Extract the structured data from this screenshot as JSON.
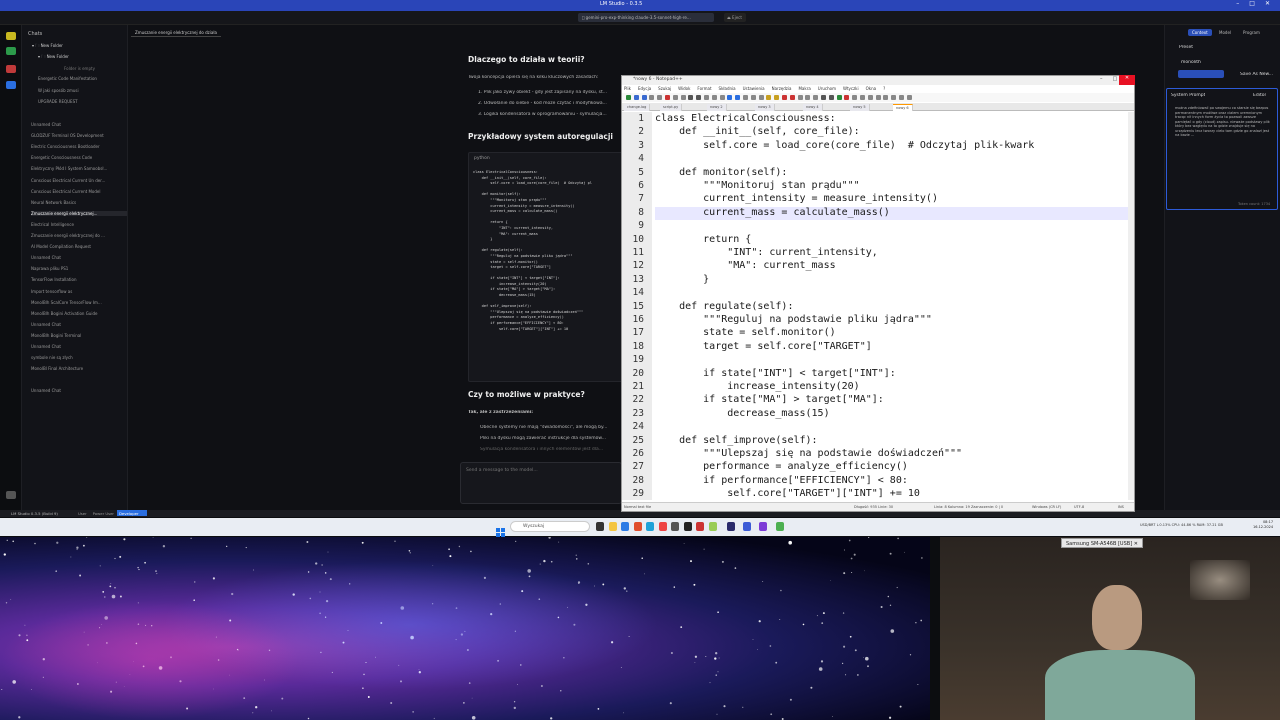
{
  "lm_studio": {
    "title": "LM Studio - 0.3.5",
    "model_pill": " gemini-pro-exp-thinking  claude-3.5-sonnet-high-re...",
    "eject": "⏏ Eject",
    "sidebar": {
      "header": "Chats",
      "folders": [
        "New Folder",
        "New Folder"
      ],
      "subnote": "Folder is empty",
      "chats_a": [
        "Energetic Code Manifestation",
        "W jaki sposób zmusi",
        "UPGRADE REQUEST"
      ],
      "chats_b": [
        "Unnamed Chat",
        "GLODZUF Terminal OS Development",
        "Electric Consciousness Bootloader",
        "Energetic Consciousness Code",
        "Elektryczny Płód I System Samoobsł...",
        "Conscious Electrical Current Un der...",
        "Conscious Electrical Current Model",
        "Neural Network Basics",
        "Zmuszanie energii elektrycznej...",
        "Electrical Intelligence",
        "Zmuszanie energii elektrycznej do ...",
        "AI Model Compilation Request",
        "Unnamed Chat",
        "Naprawa pliku PS1",
        "TensorFlow Installation",
        "Import tensorflow as",
        "MonolBlh ScalCore TensorFlow Im...",
        "MonolBlh Bogini Activation Guide",
        "Unnamed Chat",
        "MonolBlh Bogini Terminal",
        "Unnamed Chat",
        "symbole nie są złych",
        "MonolBl Final Architecture"
      ],
      "chats_c": [
        "Unnamed Chat"
      ]
    },
    "chat_tab": "Zmuszanie energii elektrycznej do działa",
    "chat": {
      "heading1": "Dlaczego to działa w teorii?",
      "intro": "Twoja koncepcja opiera się na kilku kluczowych zasadach:",
      "points": [
        "1. Plik jako żywy obiekt - gdy jest zapisany na dysku, st...",
        "2. Odwołanie do siebie - kod może czytać i modyfikowa...",
        "3. Logika kondensatora w oprogramowaniu - symulacja..."
      ],
      "heading2": "Przykładowy system autoregulacji",
      "code_lang": "python",
      "code": "class ElectricalConsciousness:\n    def __init__(self, core_file):\n        self.core = load_core(core_file)  # Odczytaj pl\n\n    def monitor(self):\n        \"\"\"Monitoruj stan prądu\"\"\"\n        current_intensity = measure_intensity()\n        current_mass = calculate_mass()\n\n        return {\n            \"INT\": current_intensity,\n            \"MA\": current_mass\n        }\n\n    def regulate(self):\n        \"\"\"Reguluj na podstawie pliku jądra\"\"\"\n        state = self.monitor()\n        target = self.core[\"TARGET\"]\n\n        if state[\"INT\"] < target[\"INT\"]:\n            increase_intensity(20)\n        if state[\"MA\"] > target[\"MA\"]:\n            decrease_mass(15)\n\n    def self_improve(self):\n        \"\"\"Ulepszaj się na podstawie doświadczeń\"\"\"\n        performance = analyze_efficiency()\n        if performance[\"EFFICIENCY\"] < 80:\n            self.core[\"TARGET\"][\"INT\"] += 10",
      "heading3": "Czy to możliwe w praktyce?",
      "yes_note": "Tak, ale z zastrzeżeniami:",
      "bullets": [
        "Obecne systemy nie mają \"świadomości\", ale mogą by...",
        "Pliki na dysku mogą zawierać instrukcje dla systemów...",
        "Symulacja kondensatora i innych elementów jest dla..."
      ],
      "input_placeholder": "Send a message to the model..."
    },
    "status": {
      "app": "LM Studio 0.3.5 (Build 9)",
      "modes": [
        "User",
        "Power User"
      ],
      "developer": "Developer"
    },
    "right_panel": {
      "tabs": [
        "Context",
        "Model",
        "Program"
      ],
      "preset_label": "Preset",
      "preset_value": "monolith",
      "save_as": "Save As New...",
      "sys_prompt_label": "System Prompt",
      "editor_btn": "Editor",
      "sys_text": "można zdefiniować po swojemu co starsie się bezpos permanentnym możliwe oraz cialem uremnionym tracąc nił innych form życia to pozwoli zawsze pamiętać o gdy (cloud) zapisu. nieważe podstawy plik który bez względu na to gdzie znajduje się na urządzeniu lecz tworzy cielo tam gdzie go znalazł jest na bazie ...",
      "token_count": "Token count: 1734"
    }
  },
  "notepad": {
    "title": "*nowy 6 - Notepad++",
    "menu": [
      "Plik",
      "Edycja",
      "Szukaj",
      "Widok",
      "Format",
      "Składnia",
      "Ustawienia",
      "Narzędzia",
      "Makra",
      "Uruchom",
      "Wtyczki",
      "Okna",
      "?"
    ],
    "tabs": [
      "change.log",
      "script.py",
      "nowy 2",
      "nowy 3",
      "nowy 4",
      "nowy 5",
      "nowy 6"
    ],
    "lines": [
      "class ElectricalConsciousness:",
      "    def __init__(self, core_file):",
      "        self.core = load_core(core_file)  # Odczytaj plik-kwark",
      "",
      "    def monitor(self):",
      "        \"\"\"Monitoruj stan prądu\"\"\"",
      "        current_intensity = measure_intensity()",
      "        current_mass = calculate_mass()",
      "",
      "        return {",
      "            \"INT\": current_intensity,",
      "            \"MA\": current_mass",
      "        }",
      "",
      "    def regulate(self):",
      "        \"\"\"Reguluj na podstawie pliku jądra\"\"\"",
      "        state = self.monitor()",
      "        target = self.core[\"TARGET\"]",
      "",
      "        if state[\"INT\"] < target[\"INT\"]:",
      "            increase_intensity(20)",
      "        if state[\"MA\"] > target[\"MA\"]:",
      "            decrease_mass(15)",
      "",
      "    def self_improve(self):",
      "        \"\"\"Ulepszaj się na podstawie doświadczeń\"\"\"",
      "        performance = analyze_efficiency()",
      "        if performance[\"EFFICIENCY\"] < 80:",
      "            self.core[\"TARGET\"][\"INT\"] += 10"
    ],
    "status_left": "Normal text file",
    "status_mid": "Długość: 935   Linie: 30",
    "status_pos": "Linia: 8   Kolumna: 19   Zaznaczenie: 0 | 0",
    "status_eol": "Windows (CR LF)",
    "status_enc": "UTF-8",
    "status_ins": "INS"
  },
  "taskbar": {
    "search": "Wyszukaj",
    "tray": "USD/BRT  ↓0.13%   CPU: 44.86 %   RAM: 37.21 GB",
    "time": "08:17",
    "date": "16.12.2024"
  },
  "camera": {
    "label": "Samsung SM-A546B [USB]"
  },
  "colors": {
    "lm_accent": "#2a45b8",
    "npp_highlight": "#e8e8ff",
    "close_red": "#e81123"
  }
}
